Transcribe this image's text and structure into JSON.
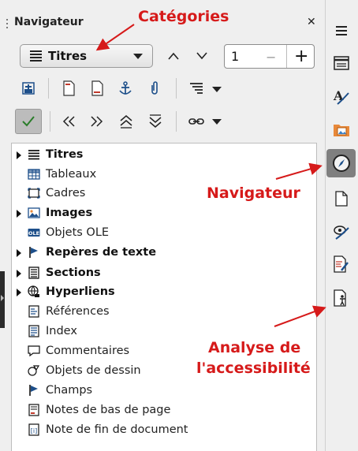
{
  "header": {
    "title": "Navigateur",
    "close_glyph": "✕"
  },
  "category_select": {
    "value": "Titres",
    "icon": "list-lines-icon"
  },
  "spinner": {
    "value": "1",
    "minus": "−",
    "plus": "+"
  },
  "tree": {
    "items": [
      {
        "label": "Titres",
        "bold": true,
        "expandable": true,
        "icon": "headings-icon"
      },
      {
        "label": "Tableaux",
        "bold": false,
        "expandable": false,
        "icon": "table-icon"
      },
      {
        "label": "Cadres",
        "bold": false,
        "expandable": false,
        "icon": "frame-icon"
      },
      {
        "label": "Images",
        "bold": true,
        "expandable": true,
        "icon": "image-icon"
      },
      {
        "label": "Objets OLE",
        "bold": false,
        "expandable": false,
        "icon": "ole-icon"
      },
      {
        "label": "Repères de texte",
        "bold": true,
        "expandable": true,
        "icon": "bookmark-flag-icon"
      },
      {
        "label": "Sections",
        "bold": true,
        "expandable": true,
        "icon": "section-icon"
      },
      {
        "label": "Hyperliens",
        "bold": true,
        "expandable": true,
        "icon": "globe-link-icon"
      },
      {
        "label": "Références",
        "bold": false,
        "expandable": false,
        "icon": "reference-icon"
      },
      {
        "label": "Index",
        "bold": false,
        "expandable": false,
        "icon": "index-icon"
      },
      {
        "label": "Commentaires",
        "bold": false,
        "expandable": false,
        "icon": "comment-icon"
      },
      {
        "label": "Objets de dessin",
        "bold": false,
        "expandable": false,
        "icon": "drawing-object-icon"
      },
      {
        "label": "Champs",
        "bold": false,
        "expandable": false,
        "icon": "field-flag-icon"
      },
      {
        "label": "Notes de bas de page",
        "bold": false,
        "expandable": false,
        "icon": "footnote-icon"
      },
      {
        "label": "Note de fin de document",
        "bold": false,
        "expandable": false,
        "icon": "endnote-icon"
      }
    ]
  },
  "annotations": {
    "categories": "Catégories",
    "navigator": "Navigateur",
    "accessibility_line1": "Analyse de",
    "accessibility_line2": "l'accessibilité",
    "color": "#d61a1a"
  },
  "colors": {
    "panel_bg": "#efefef",
    "active_sidebar_bg": "#7f7f7f",
    "check_green": "#2a7d2a"
  }
}
